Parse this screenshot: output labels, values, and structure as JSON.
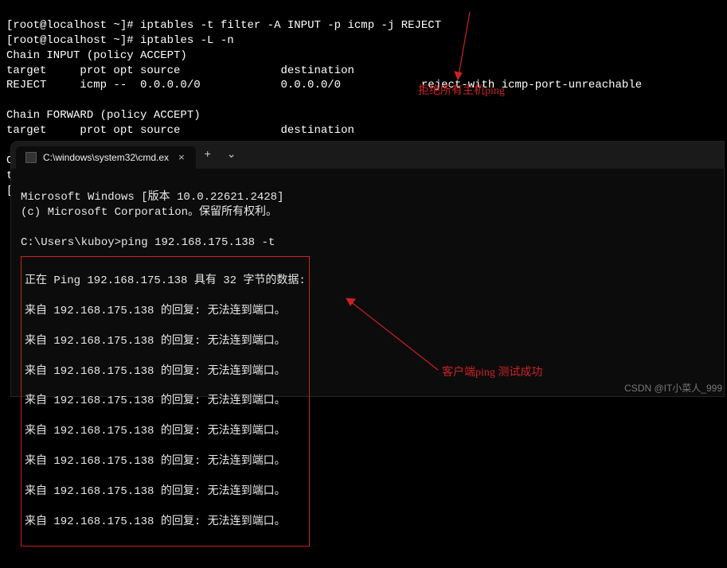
{
  "linux": {
    "prompt": "[root@localhost ~]#",
    "cmd1": "iptables -t filter -A INPUT -p icmp -j REJECT",
    "cmd2": "iptables -L -n",
    "chain_input": "Chain INPUT (policy ACCEPT)",
    "hdr": "target     prot opt source               destination",
    "rule": "REJECT     icmp --  0.0.0.0/0            0.0.0.0/0            reject-with icmp-port-unreachable",
    "chain_fwd": "Chain FORWARD (policy ACCEPT)",
    "chain_out": "Chain OUTPUT (policy ACCEPT)",
    "cut1": "ta",
    "cut2": "["
  },
  "cmd": {
    "tab_title": "C:\\windows\\system32\\cmd.ex",
    "banner1": "Microsoft Windows [版本 10.0.22621.2428]",
    "banner2": "(c) Microsoft Corporation。保留所有权利。",
    "prompt": "C:\\Users\\kuboy>",
    "cmd": "ping 192.168.175.138 -t",
    "ping_head": "正在 Ping 192.168.175.138 具有 32 字节的数据:",
    "reply": "来自 192.168.175.138 的回复: 无法连到端口。"
  },
  "annotations": {
    "a1": "拒绝所有主机ping",
    "a2": "客户端ping 测试成功"
  },
  "watermark": "CSDN @IT小菜人_999"
}
